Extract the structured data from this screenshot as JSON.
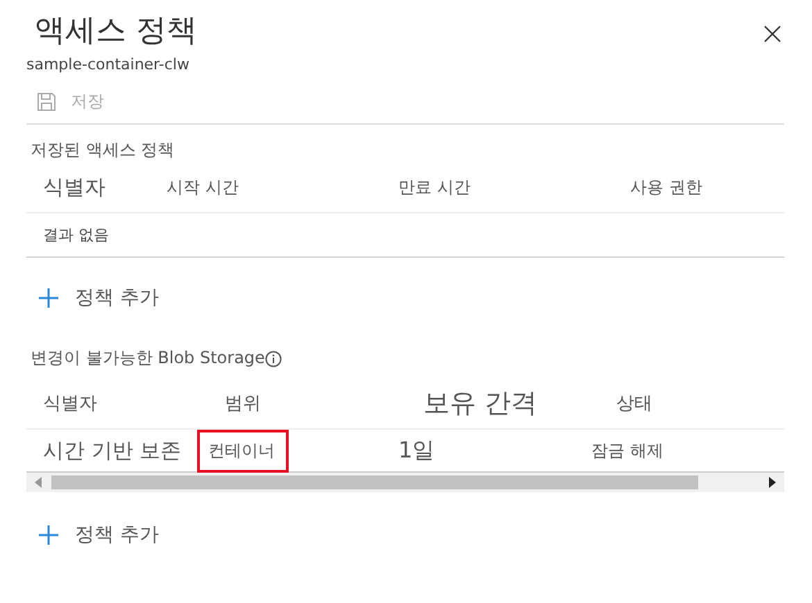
{
  "panel": {
    "title": "액세스 정책",
    "subtitle": "sample-container-clw"
  },
  "toolbar": {
    "save_button": {
      "label": "저장",
      "disabled": true
    }
  },
  "stored_policies": {
    "title": "저장된 액세스 정책",
    "columns": [
      "식별자",
      "시작 시간",
      "만료 시간",
      "사용 권한"
    ],
    "empty_message": "결과 없음",
    "add_button": "정책 추가"
  },
  "immutable_storage": {
    "title": "변경이 불가능한 Blob Storage",
    "columns": [
      "식별자",
      "범위",
      "보유 간격",
      "상태"
    ],
    "rows": [
      {
        "cells": [
          {
            "text": "시간 기반 보존",
            "highlighted": false
          },
          {
            "text": "컨테이너",
            "highlighted": true
          },
          {
            "text": "1일",
            "highlighted": false
          },
          {
            "text": "잠금 해제",
            "highlighted": false
          }
        ]
      }
    ],
    "add_button": "정책 추가"
  }
}
